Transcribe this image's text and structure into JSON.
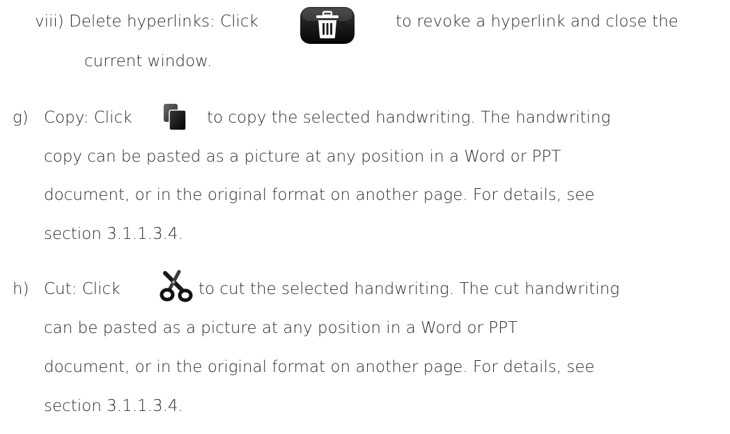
{
  "sections": {
    "viii": {
      "line1_before": "viii) Delete hyperlinks: Click",
      "icon": "trash-can-icon",
      "line1_after": "to revoke a hyperlink and close the",
      "line2": "current window."
    },
    "g": {
      "marker": "g)",
      "line1_before": "Copy: Click",
      "icon": "copy-icon",
      "line1_after": "to copy the selected handwriting. The handwriting",
      "line2": "copy can be pasted as a picture at any position in a Word or PPT",
      "line3": "document, or in the original format on another page. For details, see",
      "line4": "section 3.1.1.3.4."
    },
    "h": {
      "marker": "h)",
      "line1_before": "Cut: Click",
      "icon": "scissors-icon",
      "line1_after": "to cut the selected handwriting. The cut handwriting",
      "line2": "can be pasted as a picture at any position in a Word or PPT",
      "line3": "document, or in the original format on another page. For details, see",
      "line4": "section 3.1.1.3.4."
    }
  },
  "colors": {
    "text": "#2b2b2b",
    "icon_dark": "#1c1c1c",
    "icon_light": "#ffffff"
  }
}
